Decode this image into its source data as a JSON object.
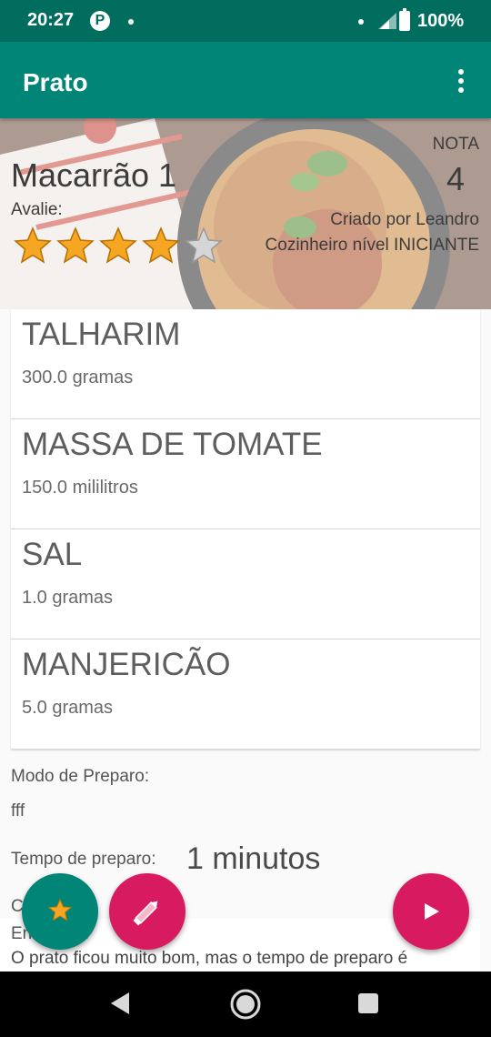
{
  "status_bar": {
    "time": "20:27",
    "battery": "100%"
  },
  "app_bar": {
    "title": "Prato"
  },
  "dish": {
    "name": "Macarrão 1",
    "rate_label": "Avalie:",
    "rating_filled": 4,
    "rating_total": 5,
    "score_label": "NOTA",
    "score": "4",
    "created_by": "Criado por Leandro",
    "chef_level": "Cozinheiro nível INICIANTE"
  },
  "ingredients": [
    {
      "name": "TALHARIM",
      "qty": "300.0 gramas"
    },
    {
      "name": "MASSA DE TOMATE",
      "qty": "150.0 mililitros"
    },
    {
      "name": "SAL",
      "qty": "1.0 gramas"
    },
    {
      "name": "MANJERICÃO",
      "qty": "5.0 gramas"
    }
  ],
  "preparation": {
    "label": "Modo de Preparo:",
    "text": "fff",
    "time_label": "Tempo de preparo:",
    "time_value": "1 minutos"
  },
  "comments": {
    "title_visible": "C           o",
    "author_visible": "En       por         aro",
    "text": "O prato ficou muito bom, mas o tempo de preparo é"
  },
  "colors": {
    "primary": "#008577",
    "primary_dark": "#006d5e",
    "accent": "#d81b60",
    "star": "#f5a623"
  }
}
